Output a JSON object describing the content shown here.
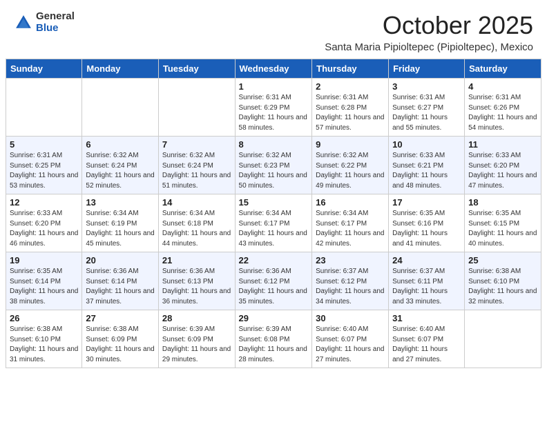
{
  "logo": {
    "general": "General",
    "blue": "Blue"
  },
  "header": {
    "month": "October 2025",
    "location": "Santa Maria Pipioltepec (Pipioltepec), Mexico"
  },
  "weekdays": [
    "Sunday",
    "Monday",
    "Tuesday",
    "Wednesday",
    "Thursday",
    "Friday",
    "Saturday"
  ],
  "weeks": [
    [
      {
        "day": "",
        "info": ""
      },
      {
        "day": "",
        "info": ""
      },
      {
        "day": "",
        "info": ""
      },
      {
        "day": "1",
        "info": "Sunrise: 6:31 AM\nSunset: 6:29 PM\nDaylight: 11 hours\nand 58 minutes."
      },
      {
        "day": "2",
        "info": "Sunrise: 6:31 AM\nSunset: 6:28 PM\nDaylight: 11 hours\nand 57 minutes."
      },
      {
        "day": "3",
        "info": "Sunrise: 6:31 AM\nSunset: 6:27 PM\nDaylight: 11 hours\nand 55 minutes."
      },
      {
        "day": "4",
        "info": "Sunrise: 6:31 AM\nSunset: 6:26 PM\nDaylight: 11 hours\nand 54 minutes."
      }
    ],
    [
      {
        "day": "5",
        "info": "Sunrise: 6:31 AM\nSunset: 6:25 PM\nDaylight: 11 hours\nand 53 minutes."
      },
      {
        "day": "6",
        "info": "Sunrise: 6:32 AM\nSunset: 6:24 PM\nDaylight: 11 hours\nand 52 minutes."
      },
      {
        "day": "7",
        "info": "Sunrise: 6:32 AM\nSunset: 6:24 PM\nDaylight: 11 hours\nand 51 minutes."
      },
      {
        "day": "8",
        "info": "Sunrise: 6:32 AM\nSunset: 6:23 PM\nDaylight: 11 hours\nand 50 minutes."
      },
      {
        "day": "9",
        "info": "Sunrise: 6:32 AM\nSunset: 6:22 PM\nDaylight: 11 hours\nand 49 minutes."
      },
      {
        "day": "10",
        "info": "Sunrise: 6:33 AM\nSunset: 6:21 PM\nDaylight: 11 hours\nand 48 minutes."
      },
      {
        "day": "11",
        "info": "Sunrise: 6:33 AM\nSunset: 6:20 PM\nDaylight: 11 hours\nand 47 minutes."
      }
    ],
    [
      {
        "day": "12",
        "info": "Sunrise: 6:33 AM\nSunset: 6:20 PM\nDaylight: 11 hours\nand 46 minutes."
      },
      {
        "day": "13",
        "info": "Sunrise: 6:34 AM\nSunset: 6:19 PM\nDaylight: 11 hours\nand 45 minutes."
      },
      {
        "day": "14",
        "info": "Sunrise: 6:34 AM\nSunset: 6:18 PM\nDaylight: 11 hours\nand 44 minutes."
      },
      {
        "day": "15",
        "info": "Sunrise: 6:34 AM\nSunset: 6:17 PM\nDaylight: 11 hours\nand 43 minutes."
      },
      {
        "day": "16",
        "info": "Sunrise: 6:34 AM\nSunset: 6:17 PM\nDaylight: 11 hours\nand 42 minutes."
      },
      {
        "day": "17",
        "info": "Sunrise: 6:35 AM\nSunset: 6:16 PM\nDaylight: 11 hours\nand 41 minutes."
      },
      {
        "day": "18",
        "info": "Sunrise: 6:35 AM\nSunset: 6:15 PM\nDaylight: 11 hours\nand 40 minutes."
      }
    ],
    [
      {
        "day": "19",
        "info": "Sunrise: 6:35 AM\nSunset: 6:14 PM\nDaylight: 11 hours\nand 38 minutes."
      },
      {
        "day": "20",
        "info": "Sunrise: 6:36 AM\nSunset: 6:14 PM\nDaylight: 11 hours\nand 37 minutes."
      },
      {
        "day": "21",
        "info": "Sunrise: 6:36 AM\nSunset: 6:13 PM\nDaylight: 11 hours\nand 36 minutes."
      },
      {
        "day": "22",
        "info": "Sunrise: 6:36 AM\nSunset: 6:12 PM\nDaylight: 11 hours\nand 35 minutes."
      },
      {
        "day": "23",
        "info": "Sunrise: 6:37 AM\nSunset: 6:12 PM\nDaylight: 11 hours\nand 34 minutes."
      },
      {
        "day": "24",
        "info": "Sunrise: 6:37 AM\nSunset: 6:11 PM\nDaylight: 11 hours\nand 33 minutes."
      },
      {
        "day": "25",
        "info": "Sunrise: 6:38 AM\nSunset: 6:10 PM\nDaylight: 11 hours\nand 32 minutes."
      }
    ],
    [
      {
        "day": "26",
        "info": "Sunrise: 6:38 AM\nSunset: 6:10 PM\nDaylight: 11 hours\nand 31 minutes."
      },
      {
        "day": "27",
        "info": "Sunrise: 6:38 AM\nSunset: 6:09 PM\nDaylight: 11 hours\nand 30 minutes."
      },
      {
        "day": "28",
        "info": "Sunrise: 6:39 AM\nSunset: 6:09 PM\nDaylight: 11 hours\nand 29 minutes."
      },
      {
        "day": "29",
        "info": "Sunrise: 6:39 AM\nSunset: 6:08 PM\nDaylight: 11 hours\nand 28 minutes."
      },
      {
        "day": "30",
        "info": "Sunrise: 6:40 AM\nSunset: 6:07 PM\nDaylight: 11 hours\nand 27 minutes."
      },
      {
        "day": "31",
        "info": "Sunrise: 6:40 AM\nSunset: 6:07 PM\nDaylight: 11 hours\nand 27 minutes."
      },
      {
        "day": "",
        "info": ""
      }
    ]
  ]
}
